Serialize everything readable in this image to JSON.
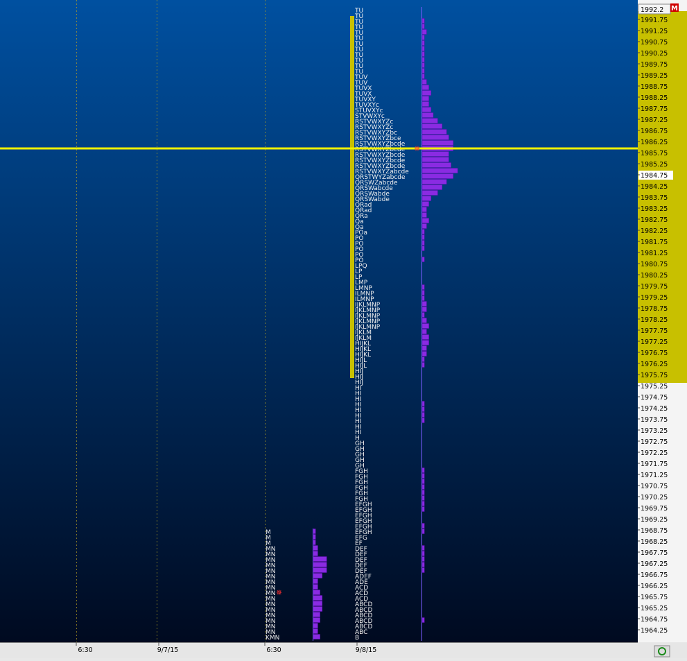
{
  "corner_badge": "M",
  "chart_data": {
    "type": "tpo-market-profile",
    "y_axis": {
      "min": 1964.25,
      "max": 1992.25,
      "tick_step": 0.5,
      "top_label": "1992.2",
      "highlighted_price": "1984.75"
    },
    "value_area": [
      1975.75,
      1991.75
    ],
    "current_price": 1986.0,
    "x_axis": {
      "ticks": [
        "6:30",
        "9/7/15",
        "6:30",
        "9/8/15"
      ]
    },
    "profiles": [
      {
        "name": "9/7/15 session",
        "rows": [
          {
            "price": 1968.75,
            "letters": "M",
            "tpo": 1
          },
          {
            "price": 1968.5,
            "letters": "M",
            "tpo": 1
          },
          {
            "price": 1968.25,
            "letters": "M",
            "tpo": 1
          },
          {
            "price": 1968.0,
            "letters": "MN",
            "tpo": 2
          },
          {
            "price": 1967.75,
            "letters": "MN",
            "tpo": 2
          },
          {
            "price": 1967.5,
            "letters": "MN",
            "tpo": 6
          },
          {
            "price": 1967.25,
            "letters": "MN",
            "tpo": 6
          },
          {
            "price": 1967.0,
            "letters": "MN",
            "tpo": 6
          },
          {
            "price": 1966.75,
            "letters": "MN",
            "tpo": 4
          },
          {
            "price": 1966.5,
            "letters": "MN",
            "tpo": 2
          },
          {
            "price": 1966.25,
            "letters": "MN",
            "tpo": 2
          },
          {
            "price": 1966.0,
            "letters": "MN",
            "tpo": 3
          },
          {
            "price": 1965.75,
            "letters": "MN",
            "tpo": 4
          },
          {
            "price": 1965.5,
            "letters": "MN",
            "tpo": 4
          },
          {
            "price": 1965.25,
            "letters": "MN",
            "tpo": 4
          },
          {
            "price": 1965.0,
            "letters": "MN",
            "tpo": 3
          },
          {
            "price": 1964.75,
            "letters": "MN",
            "tpo": 3
          },
          {
            "price": 1964.5,
            "letters": "MN",
            "tpo": 2
          },
          {
            "price": 1964.25,
            "letters": "MN",
            "tpo": 2
          },
          {
            "price": 1964.0,
            "letters": "KMN",
            "tpo": 3
          }
        ]
      },
      {
        "name": "9/8/15 session",
        "rows": [
          {
            "price": 1992.25,
            "letters": "TU",
            "tpo": 0
          },
          {
            "price": 1992.0,
            "letters": "TU",
            "tpo": 0
          },
          {
            "price": 1991.75,
            "letters": "TU",
            "tpo": 1
          },
          {
            "price": 1991.5,
            "letters": "TU",
            "tpo": 1
          },
          {
            "price": 1991.25,
            "letters": "TU",
            "tpo": 2
          },
          {
            "price": 1991.0,
            "letters": "TU",
            "tpo": 1
          },
          {
            "price": 1990.75,
            "letters": "TU",
            "tpo": 1
          },
          {
            "price": 1990.5,
            "letters": "TU",
            "tpo": 1
          },
          {
            "price": 1990.25,
            "letters": "TU",
            "tpo": 1
          },
          {
            "price": 1990.0,
            "letters": "TU",
            "tpo": 1
          },
          {
            "price": 1989.75,
            "letters": "TU",
            "tpo": 1
          },
          {
            "price": 1989.5,
            "letters": "TU",
            "tpo": 1
          },
          {
            "price": 1989.25,
            "letters": "TUV",
            "tpo": 1
          },
          {
            "price": 1989.0,
            "letters": "TUV",
            "tpo": 2
          },
          {
            "price": 1988.75,
            "letters": "TUVX",
            "tpo": 3
          },
          {
            "price": 1988.5,
            "letters": "TUVX",
            "tpo": 4
          },
          {
            "price": 1988.25,
            "letters": "TUVXY",
            "tpo": 3
          },
          {
            "price": 1988.0,
            "letters": "TUVXYc",
            "tpo": 3
          },
          {
            "price": 1987.75,
            "letters": "STUVXYc",
            "tpo": 4
          },
          {
            "price": 1987.5,
            "letters": "STVWXYc",
            "tpo": 5
          },
          {
            "price": 1987.25,
            "letters": "RSTVWXYZc",
            "tpo": 7
          },
          {
            "price": 1987.0,
            "letters": "RSTVWXYZc",
            "tpo": 9
          },
          {
            "price": 1986.75,
            "letters": "RSTVWXYZbc",
            "tpo": 11
          },
          {
            "price": 1986.5,
            "letters": "RSTVWXYZbce",
            "tpo": 12
          },
          {
            "price": 1986.25,
            "letters": "RSTVWXYZbcde",
            "tpo": 14
          },
          {
            "price": 1986.0,
            "letters": "RSTVWXYZbcde",
            "tpo": 14
          },
          {
            "price": 1985.75,
            "letters": "RSTVWXYZbcde",
            "tpo": 12
          },
          {
            "price": 1985.5,
            "letters": "RSTVWXYZbcde",
            "tpo": 12
          },
          {
            "price": 1985.25,
            "letters": "RSTVWXYZbcde",
            "tpo": 13
          },
          {
            "price": 1985.0,
            "letters": "RSTVWXYZabcde",
            "tpo": 16
          },
          {
            "price": 1984.75,
            "letters": "QRSTWYZabcde",
            "tpo": 14
          },
          {
            "price": 1984.5,
            "letters": "QRSWZabcde",
            "tpo": 11
          },
          {
            "price": 1984.25,
            "letters": "QRSWabcde",
            "tpo": 9
          },
          {
            "price": 1984.0,
            "letters": "QRSWabde",
            "tpo": 7
          },
          {
            "price": 1983.75,
            "letters": "QRSWabde",
            "tpo": 4
          },
          {
            "price": 1983.5,
            "letters": "QRad",
            "tpo": 3
          },
          {
            "price": 1983.25,
            "letters": "QRad",
            "tpo": 2
          },
          {
            "price": 1983.0,
            "letters": "QRa",
            "tpo": 2
          },
          {
            "price": 1982.75,
            "letters": "Qa",
            "tpo": 3
          },
          {
            "price": 1982.5,
            "letters": "Qa",
            "tpo": 2
          },
          {
            "price": 1982.25,
            "letters": "POa",
            "tpo": 1
          },
          {
            "price": 1982.0,
            "letters": "PO",
            "tpo": 1
          },
          {
            "price": 1981.75,
            "letters": "PO",
            "tpo": 1
          },
          {
            "price": 1981.5,
            "letters": "PO",
            "tpo": 1
          },
          {
            "price": 1981.25,
            "letters": "PO",
            "tpo": 0
          },
          {
            "price": 1981.0,
            "letters": "PO",
            "tpo": 1
          },
          {
            "price": 1980.75,
            "letters": "LPQ",
            "tpo": 0
          },
          {
            "price": 1980.5,
            "letters": "LP",
            "tpo": 0
          },
          {
            "price": 1980.25,
            "letters": "LP",
            "tpo": 0
          },
          {
            "price": 1980.0,
            "letters": "LMP",
            "tpo": 0
          },
          {
            "price": 1979.75,
            "letters": "LMNP",
            "tpo": 1
          },
          {
            "price": 1979.5,
            "letters": "ILMNP",
            "tpo": 1
          },
          {
            "price": 1979.25,
            "letters": "ILMNP",
            "tpo": 1
          },
          {
            "price": 1979.0,
            "letters": "IJKLMNP",
            "tpo": 2
          },
          {
            "price": 1978.75,
            "letters": "IJKLMNP",
            "tpo": 2
          },
          {
            "price": 1978.5,
            "letters": "IJKLMNP",
            "tpo": 1
          },
          {
            "price": 1978.25,
            "letters": "IJKLMNP",
            "tpo": 2
          },
          {
            "price": 1978.0,
            "letters": "IJKLMNP",
            "tpo": 3
          },
          {
            "price": 1977.75,
            "letters": "IJKLM",
            "tpo": 2
          },
          {
            "price": 1977.5,
            "letters": "IJKLM",
            "tpo": 3
          },
          {
            "price": 1977.25,
            "letters": "HIJKL",
            "tpo": 3
          },
          {
            "price": 1977.0,
            "letters": "HIJKL",
            "tpo": 2
          },
          {
            "price": 1976.75,
            "letters": "HIJKL",
            "tpo": 2
          },
          {
            "price": 1976.5,
            "letters": "HIJL",
            "tpo": 1
          },
          {
            "price": 1976.25,
            "letters": "HIJL",
            "tpo": 1
          },
          {
            "price": 1976.0,
            "letters": "HIJ",
            "tpo": 0
          },
          {
            "price": 1975.75,
            "letters": "HIJ",
            "tpo": 0
          },
          {
            "price": 1975.5,
            "letters": "HIJ",
            "tpo": 0
          },
          {
            "price": 1975.25,
            "letters": "HI",
            "tpo": 0
          },
          {
            "price": 1975.0,
            "letters": "HI",
            "tpo": 0
          },
          {
            "price": 1974.75,
            "letters": "HI",
            "tpo": 0
          },
          {
            "price": 1974.5,
            "letters": "HI",
            "tpo": 1
          },
          {
            "price": 1974.25,
            "letters": "HI",
            "tpo": 1
          },
          {
            "price": 1974.0,
            "letters": "HI",
            "tpo": 1
          },
          {
            "price": 1973.75,
            "letters": "HI",
            "tpo": 1
          },
          {
            "price": 1973.5,
            "letters": "HI",
            "tpo": 0
          },
          {
            "price": 1973.25,
            "letters": "HI",
            "tpo": 0
          },
          {
            "price": 1973.0,
            "letters": "H",
            "tpo": 0
          },
          {
            "price": 1972.75,
            "letters": "GH",
            "tpo": 0
          },
          {
            "price": 1972.5,
            "letters": "GH",
            "tpo": 0
          },
          {
            "price": 1972.25,
            "letters": "GH",
            "tpo": 0
          },
          {
            "price": 1972.0,
            "letters": "GH",
            "tpo": 0
          },
          {
            "price": 1971.75,
            "letters": "GH",
            "tpo": 0
          },
          {
            "price": 1971.5,
            "letters": "FGH",
            "tpo": 1
          },
          {
            "price": 1971.25,
            "letters": "FGH",
            "tpo": 1
          },
          {
            "price": 1971.0,
            "letters": "FGH",
            "tpo": 1
          },
          {
            "price": 1970.75,
            "letters": "FGH",
            "tpo": 1
          },
          {
            "price": 1970.5,
            "letters": "FGH",
            "tpo": 1
          },
          {
            "price": 1970.25,
            "letters": "FGH",
            "tpo": 1
          },
          {
            "price": 1970.0,
            "letters": "EFGH",
            "tpo": 1
          },
          {
            "price": 1969.75,
            "letters": "EFGH",
            "tpo": 1
          },
          {
            "price": 1969.5,
            "letters": "EFGH",
            "tpo": 0
          },
          {
            "price": 1969.25,
            "letters": "EFGH",
            "tpo": 0
          },
          {
            "price": 1969.0,
            "letters": "EFGH",
            "tpo": 1
          },
          {
            "price": 1968.75,
            "letters": "EFGH",
            "tpo": 1
          },
          {
            "price": 1968.5,
            "letters": "EFG",
            "tpo": 0
          },
          {
            "price": 1968.25,
            "letters": "EF",
            "tpo": 0
          },
          {
            "price": 1968.0,
            "letters": "DEF",
            "tpo": 1
          },
          {
            "price": 1967.75,
            "letters": "DEF",
            "tpo": 1
          },
          {
            "price": 1967.5,
            "letters": "DEF",
            "tpo": 1
          },
          {
            "price": 1967.25,
            "letters": "DEF",
            "tpo": 1
          },
          {
            "price": 1967.0,
            "letters": "DEF",
            "tpo": 1
          },
          {
            "price": 1966.75,
            "letters": "ADEF",
            "tpo": 0
          },
          {
            "price": 1966.5,
            "letters": "ADE",
            "tpo": 0
          },
          {
            "price": 1966.25,
            "letters": "ACD",
            "tpo": 0
          },
          {
            "price": 1966.0,
            "letters": "ACD",
            "tpo": 0
          },
          {
            "price": 1965.75,
            "letters": "ACD",
            "tpo": 0
          },
          {
            "price": 1965.5,
            "letters": "ABCD",
            "tpo": 0
          },
          {
            "price": 1965.25,
            "letters": "ABCD",
            "tpo": 0
          },
          {
            "price": 1965.0,
            "letters": "ABCD",
            "tpo": 0
          },
          {
            "price": 1964.75,
            "letters": "ABCD",
            "tpo": 1
          },
          {
            "price": 1964.5,
            "letters": "ABCD",
            "tpo": 0
          },
          {
            "price": 1964.25,
            "letters": "ABC",
            "tpo": 0
          },
          {
            "price": 1964.0,
            "letters": "B",
            "tpo": 0
          }
        ]
      }
    ],
    "colors": {
      "background_top": "#0050a0",
      "background_bottom": "#000a20",
      "value_area_bar": "#c8c000",
      "current_price_line": "#f0f000",
      "histogram": "#8a2be2",
      "histogram_dark": "#5a10b0",
      "axis_bg": "#f4f4f4",
      "axis_highlight": "#c8c000",
      "gridline": "#b0a020",
      "badge": "#d00000"
    }
  }
}
